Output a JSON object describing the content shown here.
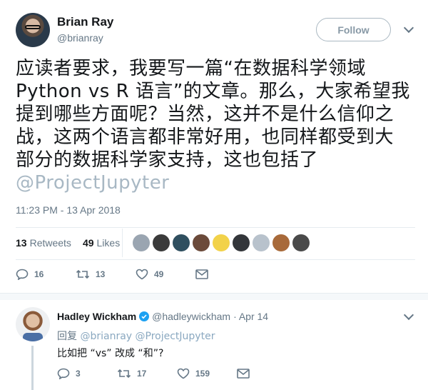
{
  "author": {
    "name": "Brian Ray",
    "handle": "@brianray",
    "follow_label": "Follow"
  },
  "tweet": {
    "lines": [
      "应读者要求，我要写一篇“在数据科学领域",
      "Python vs R 语言”的文章。那么，大家希望我",
      "提到哪些方面呢？当然，这并不是什么信仰之",
      "战，这两个语言都非常好用，也同样都受到大",
      "部分的数据科学家支持，这也包括了"
    ],
    "mention": "@ProjectJupyter",
    "timestamp": "11:23 PM - 13 Apr 2018"
  },
  "stats": {
    "retweets_count": "13",
    "retweets_label": "Retweets",
    "likes_count": "49",
    "likes_label": "Likes"
  },
  "likers": [
    {
      "name": "liker-1",
      "color": "#9aa5b1"
    },
    {
      "name": "liker-2",
      "color": "#3b3b3b"
    },
    {
      "name": "liker-3",
      "color": "#2f4f5f"
    },
    {
      "name": "liker-4",
      "color": "#6b4a3a"
    },
    {
      "name": "liker-5",
      "color": "#f2d24a"
    },
    {
      "name": "liker-6",
      "color": "#33363a"
    },
    {
      "name": "liker-7",
      "color": "#b8c2cc"
    },
    {
      "name": "liker-8",
      "color": "#a86a3a"
    },
    {
      "name": "liker-9",
      "color": "#4a4a4a"
    }
  ],
  "actions": {
    "reply_count": "16",
    "retweet_count": "13",
    "like_count": "49"
  },
  "reply": {
    "name": "Hadley Wickham",
    "handle": "@hadleywickham",
    "date": "· Apr 14",
    "reply_prefix": "回复",
    "reply_to_1": "@brianray",
    "reply_to_2": "@ProjectJupyter",
    "text": "比如把 “vs” 改成 “和”?",
    "reply_count": "3",
    "retweet_count": "17",
    "like_count": "159"
  },
  "colors": {
    "accent": "#1da1f2",
    "text_secondary": "#657786",
    "divider": "#e6ecf0"
  }
}
